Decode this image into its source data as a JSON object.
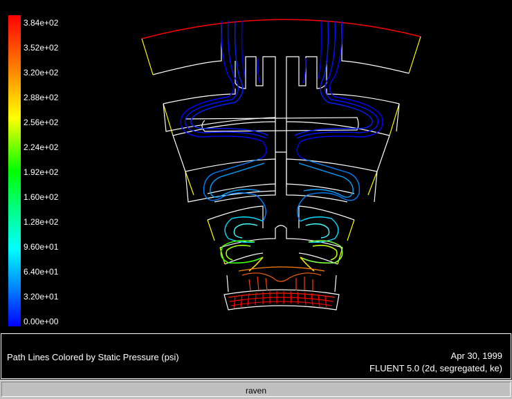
{
  "colorbar": {
    "ticks": [
      "3.84e+02",
      "3.52e+02",
      "3.20e+02",
      "2.88e+02",
      "2.56e+02",
      "2.24e+02",
      "1.92e+02",
      "1.60e+02",
      "1.28e+02",
      "9.60e+01",
      "6.40e+01",
      "3.20e+01",
      "0.00e+00"
    ],
    "colors": [
      "#0000ff",
      "#0040ff",
      "#0080ff",
      "#00c0ff",
      "#00ffff",
      "#00ff80",
      "#00ff00",
      "#80ff00",
      "#ffff00",
      "#ffc000",
      "#ff8000",
      "#ff4000",
      "#ff0000"
    ]
  },
  "caption": {
    "title": "Path Lines Colored by Static Pressure (psi)",
    "date": "Apr 30, 1999",
    "solver": "FLUENT 5.0 (2d, segregated, ke)"
  },
  "host": {
    "name": "raven"
  },
  "colors": {
    "background": "#000000",
    "geometry": "#ffffff",
    "inlet_arc": "#ff0000",
    "side_edges": "#ffff00",
    "status_bar": "#c0c0c0"
  },
  "chart_data": {
    "type": "contour",
    "variable": "Static Pressure",
    "units": "psi",
    "range": [
      0,
      384
    ],
    "ticks": [
      384,
      352,
      320,
      288,
      256,
      224,
      192,
      160,
      128,
      96,
      64,
      32,
      0
    ]
  }
}
